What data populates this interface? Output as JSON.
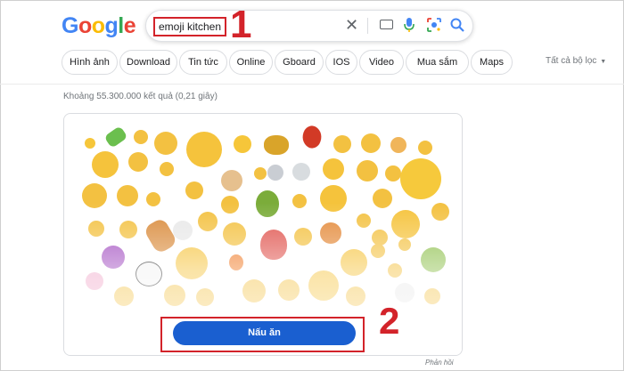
{
  "logo": {
    "letters": [
      "G",
      "o",
      "o",
      "g",
      "l",
      "e"
    ],
    "colors": [
      "#4285f4",
      "#ea4335",
      "#fbbc05",
      "#4285f4",
      "#34a853",
      "#ea4335"
    ]
  },
  "search": {
    "query": "emoji kitchen"
  },
  "icons": {
    "clear": "close-icon",
    "keyboard": "keyboard-icon",
    "mic": "mic-icon",
    "lens": "lens-icon",
    "search": "search-icon"
  },
  "annotations": {
    "step1": "1",
    "step2": "2",
    "color": "#d3232a"
  },
  "chips": [
    "Hình ảnh",
    "Download",
    "Tin tức",
    "Online",
    "Gboard",
    "IOS",
    "Video",
    "Mua sắm",
    "Maps"
  ],
  "safe_filter": {
    "label": "Tất cả bộ lọc"
  },
  "result_stats": "Khoảng 55.300.000 kết quả (0,21 giây)",
  "card": {
    "button_label": "Nấu ăn",
    "button_color": "#1a5fd0",
    "feedback": "Phản hồi"
  }
}
